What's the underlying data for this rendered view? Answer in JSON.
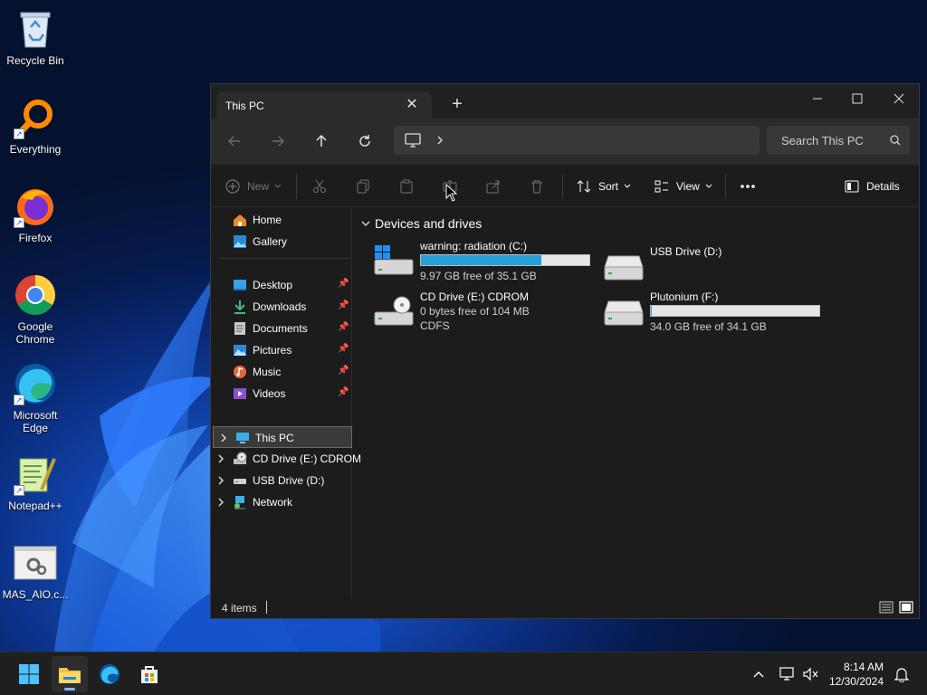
{
  "desktop": {
    "icons": [
      {
        "label": "Recycle Bin",
        "icon": "recycle-bin-icon"
      },
      {
        "label": "Everything",
        "icon": "everything-icon"
      },
      {
        "label": "Firefox",
        "icon": "firefox-icon"
      },
      {
        "label": "Google Chrome",
        "icon": "chrome-icon"
      },
      {
        "label": "Microsoft Edge",
        "icon": "edge-icon"
      },
      {
        "label": "Notepad++",
        "icon": "notepadpp-icon"
      },
      {
        "label": "MAS_AIO.c...",
        "icon": "script-file-icon"
      }
    ]
  },
  "window": {
    "tab_title": "This PC",
    "search_placeholder": "Search This PC"
  },
  "toolbar": {
    "new_label": "New",
    "sort_label": "Sort",
    "view_label": "View",
    "details_label": "Details"
  },
  "sidebar": {
    "quick": [
      {
        "label": "Home"
      },
      {
        "label": "Gallery"
      }
    ],
    "pinned": [
      {
        "label": "Desktop"
      },
      {
        "label": "Downloads"
      },
      {
        "label": "Documents"
      },
      {
        "label": "Pictures"
      },
      {
        "label": "Music"
      },
      {
        "label": "Videos"
      }
    ],
    "tree": [
      {
        "label": "This PC",
        "selected": true
      },
      {
        "label": "CD Drive (E:) CDROM"
      },
      {
        "label": "USB Drive (D:)"
      },
      {
        "label": "Network"
      }
    ]
  },
  "content": {
    "group_title": "Devices and drives",
    "drives": [
      {
        "name": "warning: radiation (C:)",
        "free_text": "9.97 GB free of 35.1 GB",
        "used_fraction": 0.716
      },
      {
        "name": "USB Drive (D:)"
      },
      {
        "name": "CD Drive (E:) CDROM",
        "free_text": "0 bytes free of 104 MB",
        "fs_text": "CDFS"
      },
      {
        "name": "Plutonium (F:)",
        "free_text": "34.0 GB free of 34.1 GB",
        "used_fraction": 0.003
      }
    ]
  },
  "status": {
    "items_text": "4 items"
  },
  "taskbar": {
    "time": "8:14 AM",
    "date": "12/30/2024"
  },
  "colors": {
    "accent": "#26a0da",
    "window_bg": "#1c1c1c",
    "taskbar_bg": "#1f1f1f"
  }
}
